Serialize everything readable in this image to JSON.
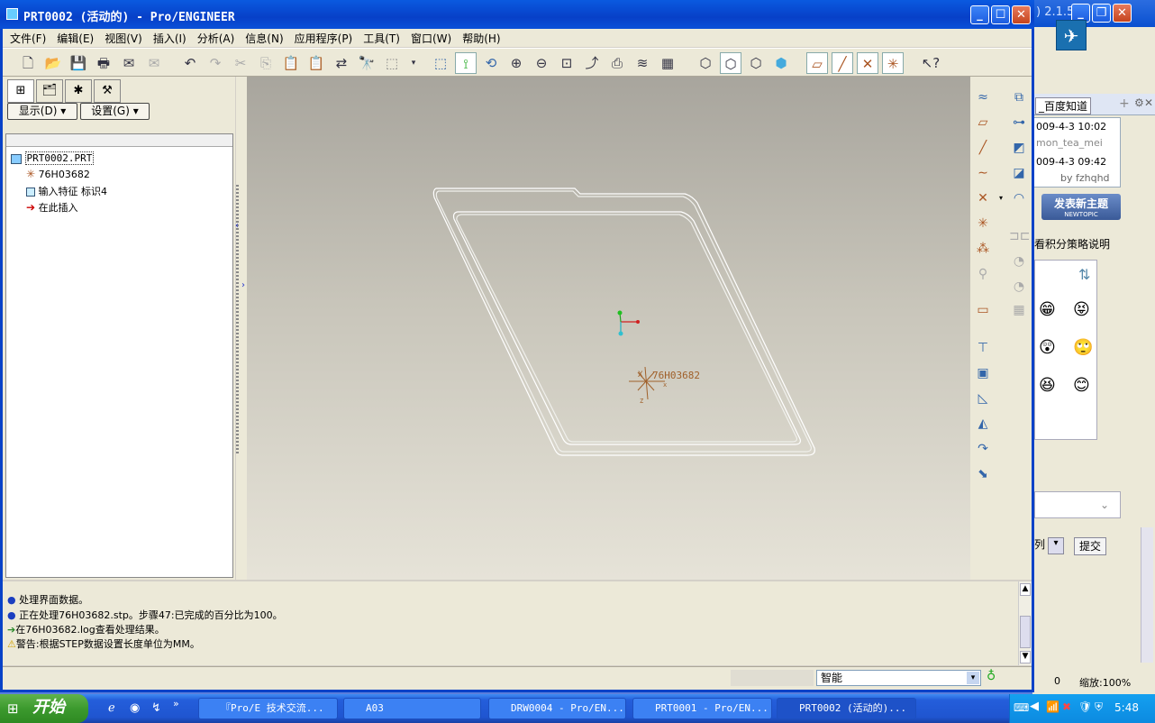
{
  "window": {
    "title": "PRT0002 (活动的) - Pro/ENGINEER"
  },
  "menu": [
    "文件(F)",
    "编辑(E)",
    "视图(V)",
    "插入(I)",
    "分析(A)",
    "信息(N)",
    "应用程序(P)",
    "工具(T)",
    "窗口(W)",
    "帮助(H)"
  ],
  "left_panel": {
    "display_btn": "显示(D)",
    "settings_btn": "设置(G)",
    "tree": [
      {
        "label": "PRT0002.PRT"
      },
      {
        "label": "76H03682"
      },
      {
        "label": "输入特征 标识4"
      },
      {
        "label": "在此插入"
      }
    ]
  },
  "viewport": {
    "csys_label": "76H03682"
  },
  "messages": [
    "处理界面数据。",
    "正在处理76H03682.stp。步骤47:已完成的百分比为100。",
    "在76H03682.log查看处理结果。",
    "警告:根据STEP数据设置长度单位为MM。"
  ],
  "status": {
    "filter": "智能"
  },
  "browser_bg": {
    "version": ") 2.1.5",
    "tab": "_百度知道",
    "post1_time": "009-4-3 10:02",
    "post1_user": "mon_tea_mei",
    "post2_time": "009-4-3 09:42",
    "post2_user": "by fzhqhd",
    "new_topic": "发表新主题",
    "new_topic_sub": "NEWTOPIC",
    "score_link": "看积分策略说明",
    "select_text": "列",
    "submit": "提交",
    "zoom": "缩放:100%",
    "count": "0"
  },
  "taskbar": {
    "start": "开始",
    "tasks": [
      "『Pro/E 技术交流...",
      "A03",
      "DRW0004 - Pro/EN...",
      "PRT0001 - Pro/EN...",
      "PRT0002 (活动的)..."
    ],
    "clock": "5:48"
  },
  "colors": {
    "title_bar": "#0a5ae0",
    "xp_face": "#ece9d8",
    "viewport_top": "#a8a59d",
    "viewport_bottom": "#e6e3d8",
    "csys_color": "#a0602a"
  }
}
